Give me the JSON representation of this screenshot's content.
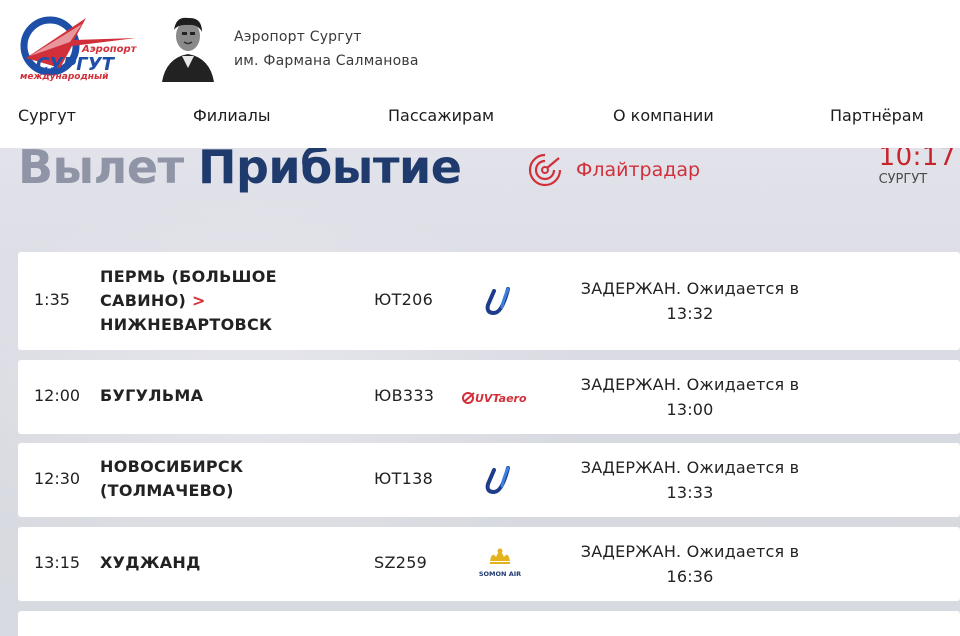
{
  "header": {
    "logo_alt": "Аэропорт Сургут международный",
    "logo_text": "СУРГУТ",
    "logo_sub": "Аэропорт",
    "logo_sub2": "международный",
    "airport_line1": "Аэропорт Сургут",
    "airport_line2": "им. Фармана Салманова"
  },
  "nav": {
    "items": [
      {
        "label": "Сургут"
      },
      {
        "label": "Филиалы"
      },
      {
        "label": "Пассажирам"
      },
      {
        "label": "О компании"
      },
      {
        "label": "Партнёрам"
      }
    ]
  },
  "board": {
    "tab_departure": "Вылет",
    "tab_arrival": "Прибытие",
    "active_tab": "arrival",
    "radar_label": "Флайтрадар",
    "clock_time": "10:17",
    "clock_city": "СУРГУТ",
    "flights": [
      {
        "time": "1:35",
        "city_a": "ПЕРМЬ (БОЛЬШОЕ САВИНО)",
        "arrow": ">",
        "city_b": "НИЖНЕВАРТОВСК",
        "number": "ЮТ206",
        "airline_logo": "utair-icon",
        "status": "ЗАДЕРЖАН. Ожидается в 13:32"
      },
      {
        "time": "12:00",
        "city": "БУГУЛЬМА",
        "number": "ЮВ333",
        "airline_logo": "uvtaero-icon",
        "airline_text": "UVTaero",
        "status": "ЗАДЕРЖАН. Ожидается в 13:00"
      },
      {
        "time": "12:30",
        "city": "НОВОСИБИРСК (ТОЛМАЧЕВО)",
        "number": "ЮТ138",
        "airline_logo": "utair-icon",
        "status": "ЗАДЕРЖАН. Ожидается в 13:33"
      },
      {
        "time": "13:15",
        "city": "ХУДЖАНД",
        "number": "SZ259",
        "airline_logo": "somon-air-icon",
        "airline_text": "SOMON AIR",
        "status": "ЗАДЕРЖАН. Ожидается в 16:36"
      }
    ]
  },
  "colors": {
    "accent_red": "#d1303a",
    "arrival_blue": "#1f3b6e",
    "departure_gray": "#8f94a6",
    "logo_blue": "#1d4ea8"
  }
}
